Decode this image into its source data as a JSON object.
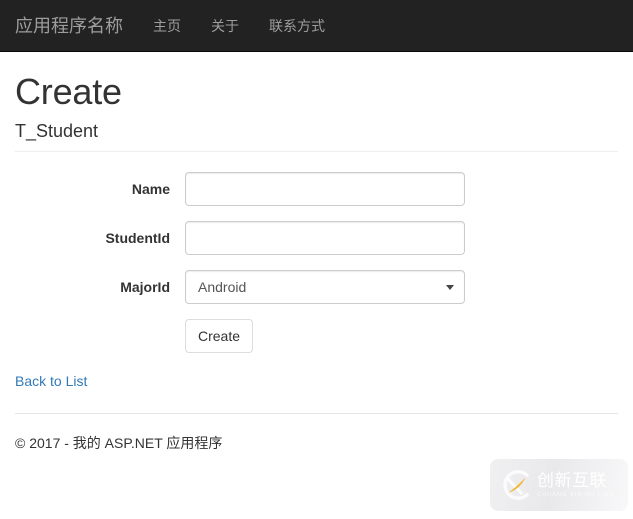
{
  "navbar": {
    "brand": "应用程序名称",
    "links": [
      {
        "label": "主页",
        "name": "nav-link-home"
      },
      {
        "label": "关于",
        "name": "nav-link-about"
      },
      {
        "label": "联系方式",
        "name": "nav-link-contact"
      }
    ],
    "background_color": "#222222",
    "text_color": "#9d9d9d"
  },
  "page": {
    "title": "Create",
    "subtitle": "T_Student"
  },
  "form": {
    "fields": [
      {
        "label": "Name",
        "type": "text",
        "value": "",
        "placeholder": ""
      },
      {
        "label": "StudentId",
        "type": "text",
        "value": "",
        "placeholder": ""
      },
      {
        "label": "MajorId",
        "type": "select",
        "value": "Android",
        "options": [
          "Android"
        ]
      }
    ],
    "submit_label": "Create"
  },
  "links": {
    "back_to_list": "Back to List",
    "link_color": "#337ab7"
  },
  "footer": {
    "copyright": "© 2017 - 我的 ASP.NET 应用程序"
  },
  "watermark": {
    "cn_text": "创新互联",
    "en_text": "CHUANG XIN HU LIAN",
    "accent_color": "#f2b632"
  }
}
